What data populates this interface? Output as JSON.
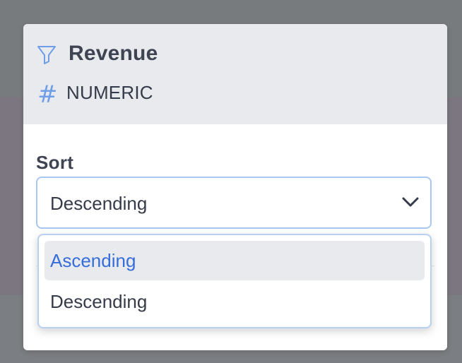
{
  "panel": {
    "title": "Revenue",
    "type_label": "NUMERIC",
    "icons": {
      "filter": "filter-icon",
      "type": "hash-icon",
      "chevron": "chevron-down-icon"
    },
    "hash_symbol": "#",
    "colors": {
      "accent": "#6f9ee8",
      "header_bg": "#e9eaee",
      "selected_text": "#356edb"
    }
  },
  "sort": {
    "label": "Sort",
    "current_value": "Descending",
    "options": [
      {
        "label": "Ascending",
        "highlighted": true
      },
      {
        "label": "Descending",
        "highlighted": false
      }
    ]
  }
}
